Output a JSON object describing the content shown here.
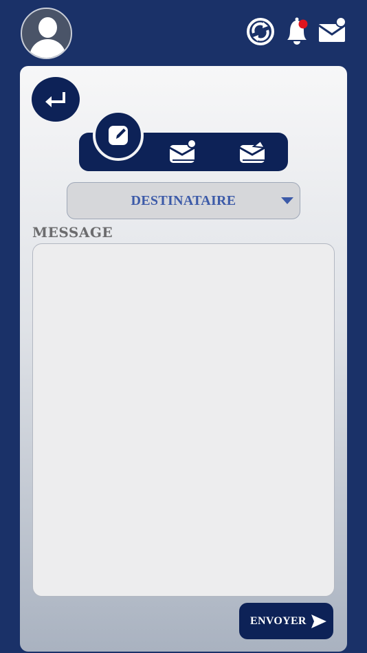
{
  "header": {
    "avatar_icon": "user-avatar-icon",
    "icons": [
      "sync-icon",
      "bell-icon",
      "mail-icon"
    ],
    "notification_dot_color": "#e0141e"
  },
  "toolbar": {
    "back_icon": "return-arrow-icon",
    "tabs": [
      "compose-icon",
      "inbox-mail-icon",
      "sent-mail-icon"
    ],
    "active_tab": "compose"
  },
  "form": {
    "recipient_label": "DESTINATAIRE",
    "message_label": "MESSAGE",
    "message_value": "",
    "send_label": "ENVOYER"
  },
  "colors": {
    "background": "#1a3168",
    "primary": "#0d2257",
    "recipient_text": "#3c5aa8"
  }
}
